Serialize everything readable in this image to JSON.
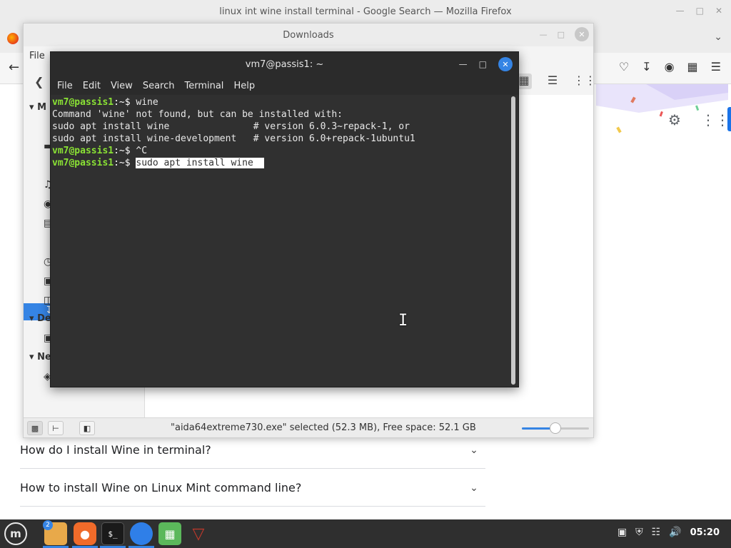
{
  "firefox": {
    "title": "linux int wine install terminal - Google Search — Mozilla Firefox",
    "faq": [
      {
        "question": "How do I install Wine in terminal?"
      },
      {
        "question": "How to install Wine on Linux Mint command line?"
      }
    ]
  },
  "downloads": {
    "title": "Downloads",
    "menu_file": "File",
    "sidebar": {
      "section_my_computer": "M",
      "section_devices": "De",
      "section_network": "Ne"
    },
    "status_text": "\"aida64extreme730.exe\" selected (52.3 MB), Free space: 52.1 GB",
    "zoom_level": 0.5
  },
  "terminal": {
    "title": "vm7@passis1: ~",
    "menu": [
      "File",
      "Edit",
      "View",
      "Search",
      "Terminal",
      "Help"
    ],
    "prompt_user": "vm7@passis1",
    "prompt_path": ":~$ ",
    "lines": {
      "cmd1": "wine",
      "out1": "Command 'wine' not found, but can be installed with:",
      "out2": "sudo apt install wine               # version 6.0.3~repack-1, or",
      "out3": "sudo apt install wine-development   # version 6.0+repack-1ubuntu1",
      "cmd2": "^C",
      "cmd3": "sudo apt install wine "
    }
  },
  "panel": {
    "files_badge": "2",
    "clock": "05:20"
  },
  "colors": {
    "accent": "#3584e4",
    "prompt_green": "#8ae234",
    "terminal_bg": "#303030"
  }
}
